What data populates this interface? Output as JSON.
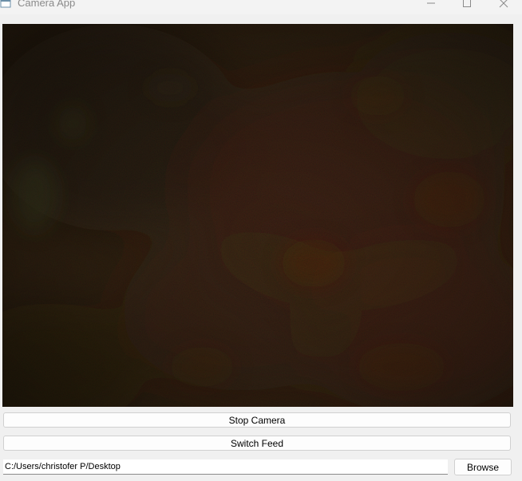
{
  "window": {
    "title": "Camera App",
    "icon": "app-window-icon",
    "controls": [
      "minimize-icon",
      "maximize-icon",
      "close-icon"
    ]
  },
  "camera": {
    "content": "live camera feed (dark, low light)"
  },
  "buttons": {
    "stop_camera": "Stop Camera",
    "switch_feed": "Switch Feed",
    "browse": "Browse"
  },
  "path": {
    "value": "C:/Users/christofer P/Desktop"
  },
  "colors": {
    "feed_base": "#1d150c",
    "feed_red": "#3d120a",
    "feed_green": "#243418"
  }
}
